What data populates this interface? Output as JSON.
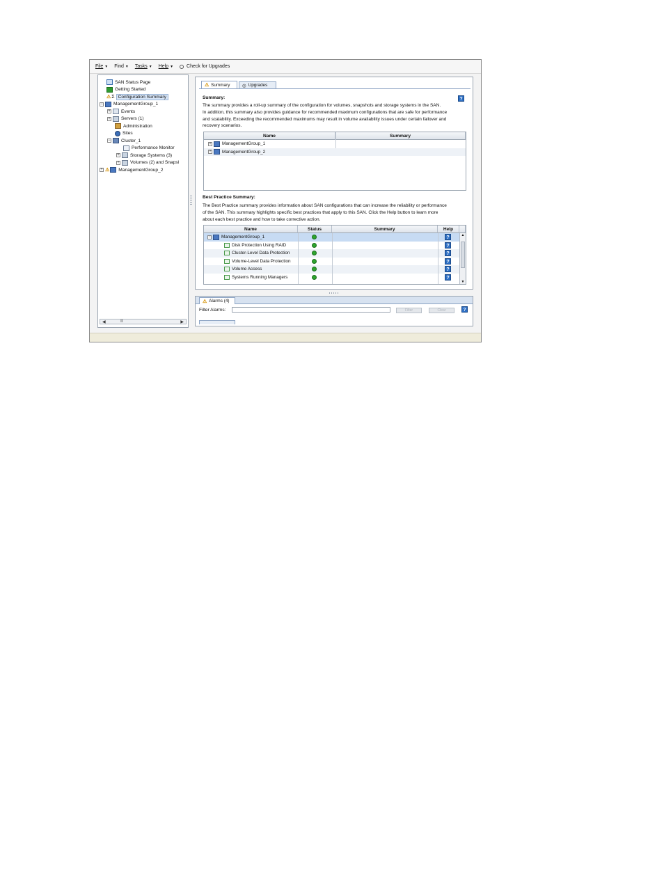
{
  "menubar": {
    "items": [
      {
        "label": "File",
        "key": "F"
      },
      {
        "label": "Find",
        "key": ""
      },
      {
        "label": "Tasks",
        "key": "T"
      },
      {
        "label": "Help",
        "key": "H"
      }
    ],
    "upgrades_label": "Check for Upgrades"
  },
  "tree": {
    "items": [
      {
        "label": "SAN Status Page",
        "icon": "home-icon"
      },
      {
        "label": "Getting Started",
        "icon": "getting-started-icon"
      },
      {
        "label": "Configuration Summary",
        "icon": "summary-icon"
      },
      {
        "label": "ManagementGroup_1",
        "icon": "management-group-icon"
      },
      {
        "label": "Events",
        "icon": "events-icon"
      },
      {
        "label": "Servers (1)",
        "icon": "servers-icon"
      },
      {
        "label": "Administration",
        "icon": "administration-icon"
      },
      {
        "label": "Sites",
        "icon": "sites-icon"
      },
      {
        "label": "Cluster_1",
        "icon": "cluster-icon"
      },
      {
        "label": "Performance Monitor",
        "icon": "performance-monitor-icon"
      },
      {
        "label": "Storage Systems (3)",
        "icon": "storage-systems-icon"
      },
      {
        "label": "Volumes (2) and Snapsl",
        "icon": "volumes-icon"
      },
      {
        "label": "ManagementGroup_2",
        "icon": "management-group-icon"
      }
    ],
    "scroll_thumb": "II"
  },
  "tabs": {
    "summary": "Summary",
    "upgrades": "Upgrades"
  },
  "summary": {
    "heading": "Summary:",
    "lines": [
      "The summary provides a roll-up summary of the configuration for volumes, snapshots and storage systems in the SAN.",
      "In addition, this summary also provides guidance for recommended maximum configurations that are safe for performance",
      "and scalability. Exceeding the recommended maximums may result in volume availability issues under certain failover and",
      "recovery scenarios."
    ],
    "table": {
      "columns": [
        "Name",
        "Summary"
      ],
      "rows": [
        "ManagementGroup_1",
        "ManagementGroup_2"
      ]
    }
  },
  "best_practice": {
    "heading": "Best Practice Summary:",
    "lines": [
      "The Best Practice summary provides information about SAN configurations that can increase the reliability or performance",
      "of the SAN. This summary highlights specific best practices that apply to this SAN. Click the Help button to learn more",
      "about each best practice and how to take corrective action."
    ],
    "table": {
      "columns": [
        "Name",
        "Status",
        "Summary",
        "Help"
      ],
      "rows": [
        {
          "name": "ManagementGroup_1",
          "status": "ok"
        },
        {
          "name": "Disk Protection Using RAID",
          "status": "ok"
        },
        {
          "name": "Cluster-Level Data Protection",
          "status": "ok"
        },
        {
          "name": "Volume-Level Data Protection",
          "status": "ok"
        },
        {
          "name": "Volume Access",
          "status": "ok"
        },
        {
          "name": "Systems Running Managers",
          "status": "ok"
        }
      ]
    }
  },
  "alarms": {
    "tab_label": "Alarms (4)",
    "filter_label": "Filter Alarms:",
    "filter_value": "",
    "filter_button": "Filter",
    "clear_button": "Clear"
  },
  "help_label": "?",
  "colors": {
    "accent": "#2d6fc4",
    "ok": "#2ea52e",
    "warning": "#d49000",
    "selection": "#c7dbf3"
  }
}
